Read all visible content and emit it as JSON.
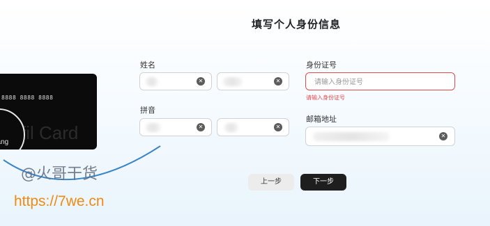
{
  "title": "填写个人身份信息",
  "labels": {
    "name": "姓名",
    "pinyin": "拼音",
    "id_number": "身份证号",
    "email": "邮箱地址"
  },
  "id_input": {
    "placeholder": "请输入身份证号",
    "error": "请输入身份证号"
  },
  "buttons": {
    "prev": "上一步",
    "next": "下一步"
  },
  "card": {
    "number": "8888 8888 8888",
    "brand_text": "fil Card",
    "holder_partial": "hang"
  },
  "watermark": {
    "line1": "@火哥干货",
    "line2": "https://7we.cn"
  },
  "colors": {
    "error": "#e5484d",
    "primary_button": "#1e1e1e",
    "watermark_orange": "#ef8a12"
  }
}
